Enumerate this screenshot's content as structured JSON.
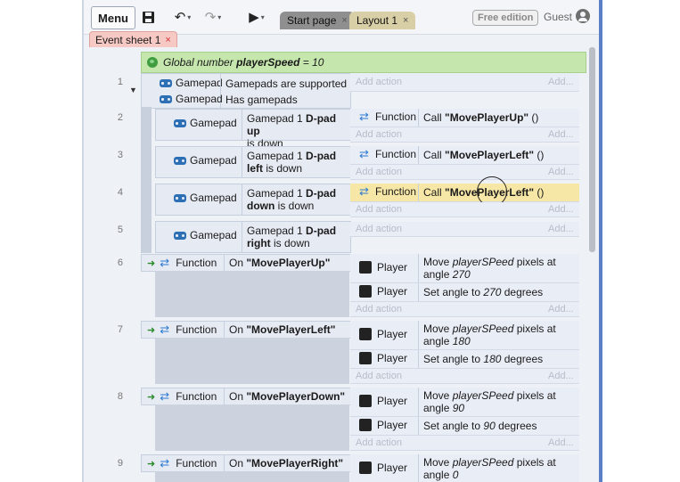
{
  "toolbar": {
    "menu_label": "Menu",
    "tabs": [
      {
        "label": "Start page",
        "close": "×"
      },
      {
        "label": "Layout 1",
        "close": "×"
      }
    ],
    "edition_label": "Free edition",
    "user_label": "Guest"
  },
  "sheet_tab": {
    "label": "Event sheet 1",
    "close": "×"
  },
  "global_var": {
    "prefix": "Global number",
    "name": "playerSpeed",
    "suffix": "= 10"
  },
  "events": {
    "e1": {
      "num": "1",
      "cond1_obj": "Gamepad",
      "cond1_text": "Gamepads are supported",
      "cond2_obj": "Gamepad",
      "cond2_text": "Has gamepads",
      "add_action": "Add action",
      "add": "Add..."
    },
    "e2": {
      "num": "2",
      "obj": "Gamepad",
      "text1": "Gamepad 1 ",
      "bold": "D-pad up",
      "text2": "is down",
      "act_obj": "Function",
      "act_pre": "Call ",
      "act_bold": "\"MovePlayerUp\"",
      "act_post": " ()",
      "add_action": "Add action",
      "add": "Add..."
    },
    "e3": {
      "num": "3",
      "obj": "Gamepad",
      "text1": "Gamepad 1 ",
      "bold": "D-pad",
      "bold2": "left",
      "text2": " is down",
      "act_obj": "Function",
      "act_pre": "Call ",
      "act_bold": "\"MovePlayerLeft\"",
      "act_post": " ()",
      "add_action": "Add action",
      "add": "Add..."
    },
    "e4": {
      "num": "4",
      "obj": "Gamepad",
      "text1": "Gamepad 1 ",
      "bold": "D-pad",
      "bold2": "down",
      "text2": " is down",
      "act_obj": "Function",
      "act_pre": "Call ",
      "act_bold": "\"MovePlayerLeft\"",
      "act_post": " ()",
      "add_action": "Add action",
      "add": "Add..."
    },
    "e5": {
      "num": "5",
      "obj": "Gamepad",
      "text1": "Gamepad 1 ",
      "bold": "D-pad",
      "bold2": "right",
      "text2": " is down",
      "add_action": "Add action",
      "add": "Add..."
    },
    "e6": {
      "num": "6",
      "obj": "Function",
      "on": "On ",
      "name": "\"MovePlayerUp\"",
      "a1_obj": "Player",
      "a1_pre": "Move ",
      "a1_it": "playerSPeed",
      "a1_post": " pixels at",
      "a1_line2_pre": "angle ",
      "a1_angle": "270",
      "a2_obj": "Player",
      "a2_pre": "Set angle to ",
      "a2_it": "270",
      "a2_post": " degrees",
      "add_action": "Add action",
      "add": "Add..."
    },
    "e7": {
      "num": "7",
      "obj": "Function",
      "on": "On ",
      "name": "\"MovePlayerLeft\"",
      "a1_obj": "Player",
      "a1_pre": "Move ",
      "a1_it": "playerSPeed",
      "a1_post": " pixels at",
      "a1_line2_pre": "angle ",
      "a1_angle": "180",
      "a2_obj": "Player",
      "a2_pre": "Set angle to ",
      "a2_it": "180",
      "a2_post": " degrees",
      "add_action": "Add action",
      "add": "Add..."
    },
    "e8": {
      "num": "8",
      "obj": "Function",
      "on": "On ",
      "name": "\"MovePlayerDown\"",
      "a1_obj": "Player",
      "a1_pre": "Move ",
      "a1_it": "playerSPeed",
      "a1_post": " pixels at",
      "a1_line2_pre": "angle ",
      "a1_angle": "90",
      "a2_obj": "Player",
      "a2_pre": "Set angle to ",
      "a2_it": "90",
      "a2_post": " degrees",
      "add_action": "Add action",
      "add": "Add..."
    },
    "e9": {
      "num": "9",
      "obj": "Function",
      "on": "On ",
      "name": "\"MovePlayerRight\"",
      "a1_obj": "Player",
      "a1_pre": "Move ",
      "a1_it": "playerSPeed",
      "a1_post": " pixels at",
      "a1_line2_pre": "angle ",
      "a1_angle": "0"
    }
  }
}
